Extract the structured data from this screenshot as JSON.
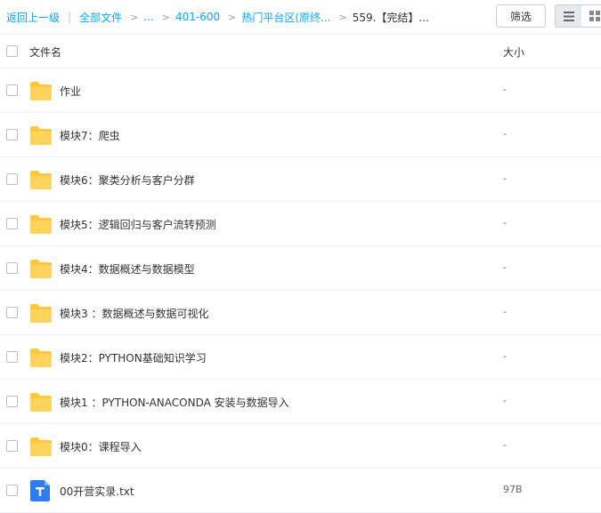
{
  "breadcrumb": {
    "back": "返回上一级",
    "separator": "|",
    "root": "全部文件",
    "items": [
      "...",
      "401-600",
      "热门平台区(原终...",
      "559.【完结】..."
    ]
  },
  "toolbar": {
    "filter_label": "筛选",
    "view_modes": [
      "list-view-icon",
      "grid-view-icon"
    ],
    "active_view": "list"
  },
  "columns": {
    "name": "文件名",
    "size": "大小"
  },
  "files": [
    {
      "name": "作业",
      "size": "-",
      "type": "folder"
    },
    {
      "name": "模块7：爬虫",
      "size": "-",
      "type": "folder"
    },
    {
      "name": "模块6：聚类分析与客户分群",
      "size": "-",
      "type": "folder"
    },
    {
      "name": "模块5：逻辑回归与客户流转预测",
      "size": "-",
      "type": "folder"
    },
    {
      "name": "模块4：数据概述与数据模型",
      "size": "-",
      "type": "folder"
    },
    {
      "name": "模块3 ：数据概述与数据可视化",
      "size": "-",
      "type": "folder"
    },
    {
      "name": "模块2：PYTHON基础知识学习",
      "size": "-",
      "type": "folder"
    },
    {
      "name": "模块1 ：PYTHON-ANACONDA 安装与数据导入",
      "size": "-",
      "type": "folder"
    },
    {
      "name": "模块0：课程导入",
      "size": "-",
      "type": "folder"
    },
    {
      "name": "00开营实录.txt",
      "size": "97B",
      "type": "txt"
    }
  ],
  "colors": {
    "link": "#06a7ff",
    "folder": "#ffc93e",
    "txt": "#2c7cf6"
  }
}
